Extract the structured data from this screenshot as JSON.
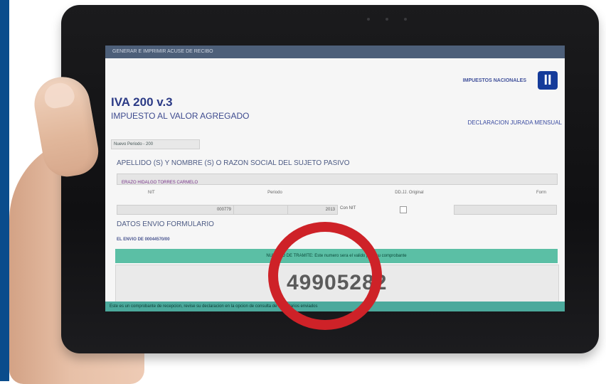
{
  "window": {
    "top_bar_text": "GENERAR E IMPRIMIR ACUSE DE RECIBO"
  },
  "header": {
    "title": "IVA 200 v.3",
    "subtitle": "IMPUESTO AL VALOR AGREGADO",
    "logo_text": "IMPUESTOS NACIONALES",
    "logo_letter": "II",
    "declaration": "DECLARACION JURADA MENSUAL"
  },
  "form": {
    "period_label": "Nuevo Periodo - 200",
    "section1_title": "APELLIDO (S) Y NOMBRE (S) O RAZON SOCIAL DEL SUJETO PASIVO",
    "name_value": "ERAZO HIDALGO TORRES CARMELO",
    "row_labels": [
      "NIT",
      "Periodo",
      "DD.JJ. Original",
      "Form"
    ],
    "row_values": [
      "000779",
      "2013",
      "Con NIT"
    ],
    "section2_title": "DATOS ENVIO FORMULARIO",
    "envio_line": "EL ENVIO DE 00044570/00",
    "teal_bar_text": "NUMERO DE TRAMITE: Este numero sera el valido para su comprobante",
    "tramite_number": "49905282",
    "bottom_text": "Este es un comprobante de recepcion, revise su declaracion en la opcion de consulta de formularios enviados"
  },
  "colors": {
    "accent_blue": "#0a4c8c",
    "teal": "#5bbfa5",
    "highlight_red": "#ce2228"
  }
}
